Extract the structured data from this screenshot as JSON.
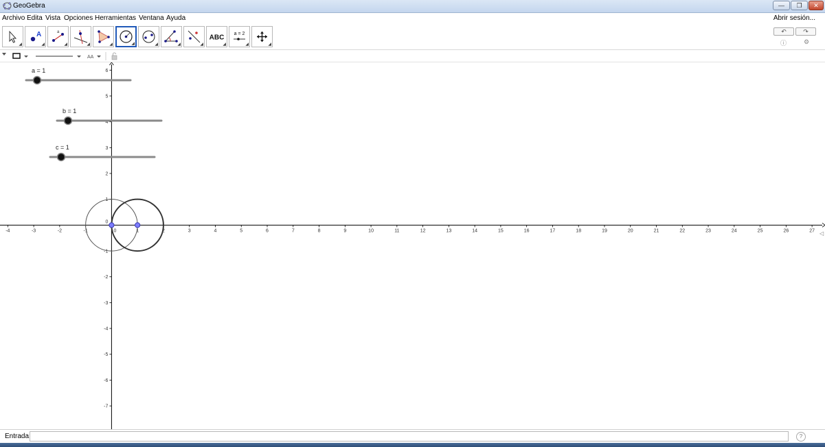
{
  "window": {
    "title": "GeoGebra",
    "buttons": [
      "minimize-icon",
      "restore-icon",
      "close-icon"
    ]
  },
  "menubar": {
    "items": [
      "Archivo",
      "Edita",
      "Vista",
      "Opciones",
      "Herramientas",
      "Ventana",
      "Ayuda"
    ],
    "login": "Abrir sesión..."
  },
  "toolbar": {
    "tools": [
      {
        "name": "move-tool-icon",
        "label": ""
      },
      {
        "name": "point-tool-icon",
        "label": ""
      },
      {
        "name": "line-tool-icon",
        "label": ""
      },
      {
        "name": "perpendicular-tool-icon",
        "label": ""
      },
      {
        "name": "polygon-tool-icon",
        "label": ""
      },
      {
        "name": "circle-center-point-tool-icon",
        "label": "",
        "selected": true
      },
      {
        "name": "ellipse-tool-icon",
        "label": ""
      },
      {
        "name": "angle-tool-icon",
        "label": ""
      },
      {
        "name": "reflect-tool-icon",
        "label": ""
      },
      {
        "name": "text-tool-icon",
        "label": "ABC"
      },
      {
        "name": "slider-tool-icon",
        "label": "a = 2"
      },
      {
        "name": "move-graphics-view-tool-icon",
        "label": ""
      }
    ],
    "undo_icon": "undo-icon",
    "redo_icon": "redo-icon"
  },
  "stylebar": {
    "font_size_label": "AA"
  },
  "graphics": {
    "x_range": [
      -4.3,
      27.5
    ],
    "y_range": [
      -7.9,
      6.3
    ],
    "x_ticks": [
      -4,
      -3,
      -2,
      -1,
      0,
      1,
      2,
      3,
      4,
      5,
      6,
      7,
      8,
      9,
      10,
      11,
      12,
      13,
      14,
      15,
      16,
      17,
      18,
      19,
      20,
      21,
      22,
      23,
      24,
      25,
      26,
      27
    ],
    "y_ticks": [
      6,
      5,
      4,
      3,
      2,
      1,
      -1,
      -2,
      -3,
      -4,
      -5,
      -6,
      -7
    ],
    "origin_label": "0",
    "sliders": [
      {
        "label": "a = 1",
        "value": 1,
        "min": -5,
        "max": 5
      },
      {
        "label": "b = 1",
        "value": 1,
        "min": -5,
        "max": 5
      },
      {
        "label": "c = 1",
        "value": 1,
        "min": -5,
        "max": 5
      }
    ],
    "circles": [
      {
        "center": [
          0,
          0
        ],
        "radius": 1,
        "style": "thin"
      },
      {
        "center": [
          1,
          0
        ],
        "radius": 1,
        "style": "thick"
      }
    ],
    "points": [
      {
        "x": 0,
        "y": 0
      },
      {
        "x": 1,
        "y": 0
      }
    ],
    "colors": {
      "axis": "#000000",
      "circle": "#444444",
      "point": "#7d7dff",
      "slider_line": "#8a8a8a"
    }
  },
  "inputbar": {
    "label": "Entrada:",
    "value": "",
    "placeholder": ""
  }
}
